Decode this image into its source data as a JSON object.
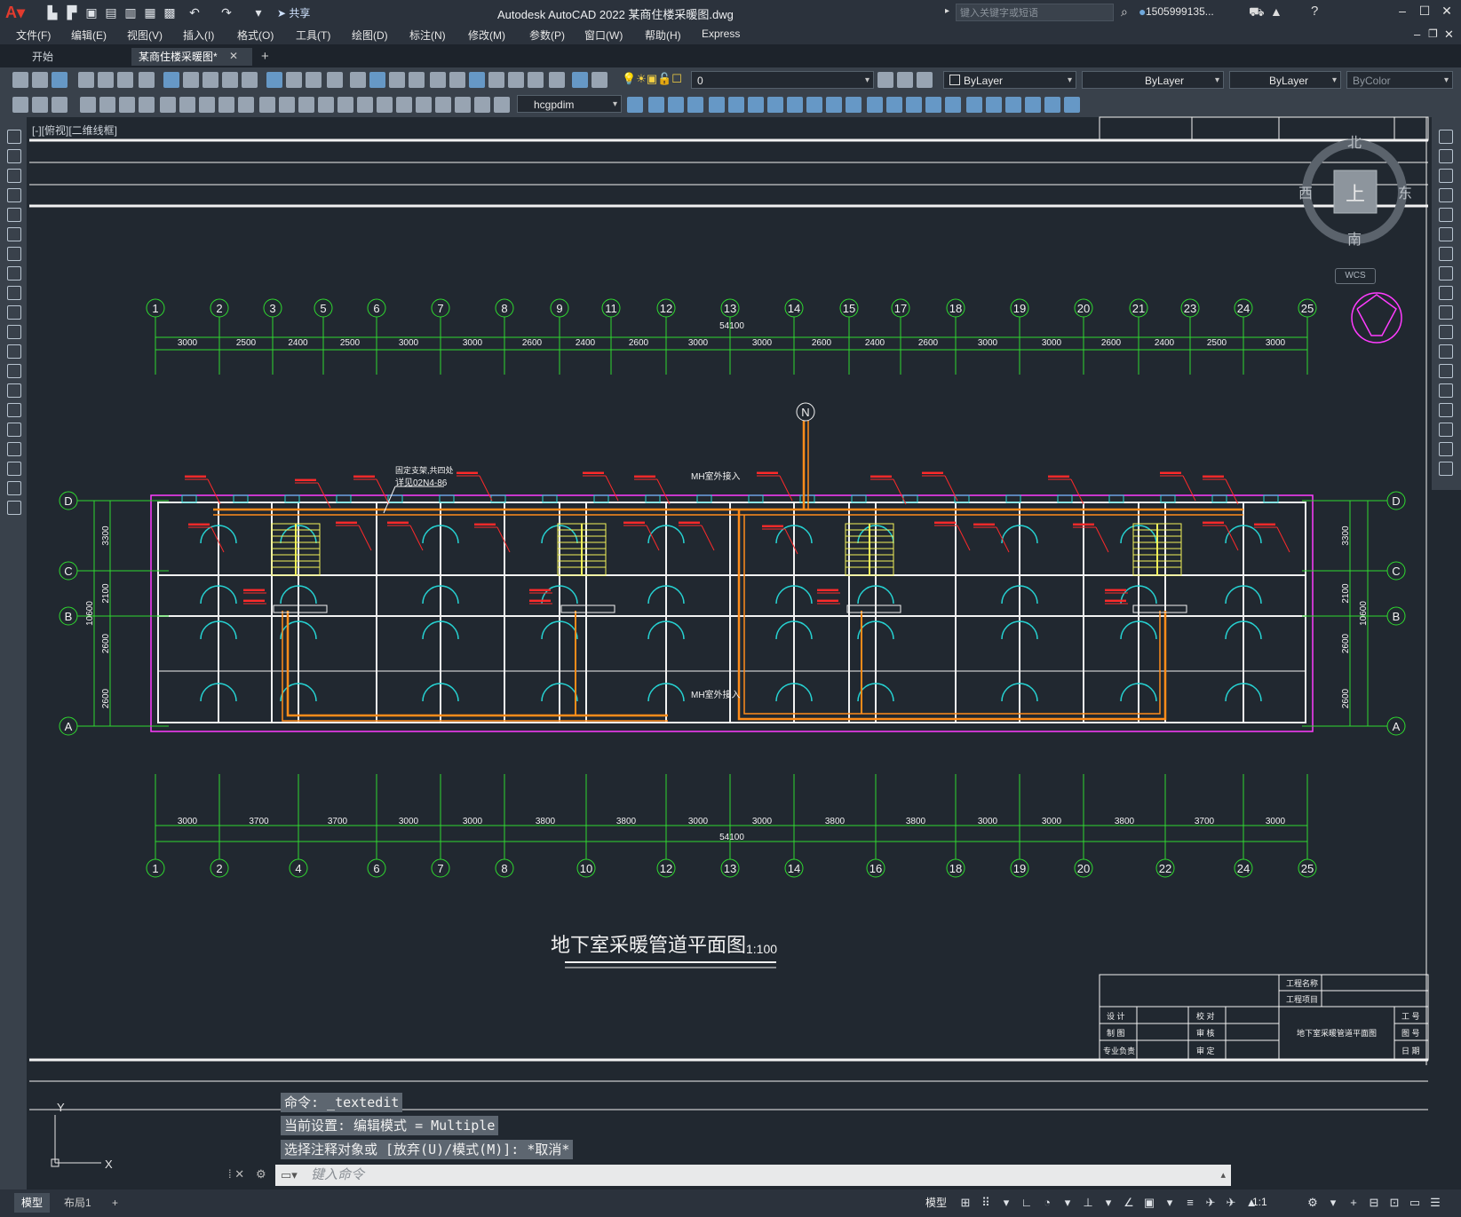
{
  "app": {
    "title": "Autodesk AutoCAD 2022    某商住楼采暖图.dwg",
    "share_label": "共享",
    "search_placeholder": "键入关键字或短语",
    "user": "1505999135...",
    "menus": [
      "文件(F)",
      "编辑(E)",
      "视图(V)",
      "插入(I)",
      "格式(O)",
      "工具(T)",
      "绘图(D)",
      "标注(N)",
      "修改(M)",
      "参数(P)",
      "窗口(W)",
      "帮助(H)",
      "Express"
    ]
  },
  "tabs": {
    "start": "开始",
    "active": "某商住楼采暖图*",
    "add": "+"
  },
  "toolbar": {
    "layer_value": "0",
    "color_value": "ByLayer",
    "linetype_value": "ByLayer",
    "lineweight_value": "ByLayer",
    "plotstyle_value": "ByColor",
    "dimstyle_value": "hcgpdim"
  },
  "view": {
    "label": "[-][俯视][二维线框]",
    "cube": {
      "north": "北",
      "south": "南",
      "east": "东",
      "west": "西",
      "top": "上"
    },
    "wcs": "WCS"
  },
  "drawing": {
    "top_axes": [
      "1",
      "2",
      "3",
      "5",
      "6",
      "7",
      "8",
      "9",
      "11",
      "12",
      "13",
      "14",
      "15",
      "17",
      "18",
      "19",
      "20",
      "21",
      "23",
      "24",
      "25"
    ],
    "top_dims": [
      "3000",
      "2500",
      "2400",
      "2500",
      "3000",
      "3000",
      "2600",
      "2400",
      "2600",
      "3000",
      "3000",
      "2600",
      "2400",
      "2600",
      "3000",
      "3000",
      "2600",
      "2400",
      "2500",
      "3000"
    ],
    "top_total": "54100",
    "bottom_axes": [
      "1",
      "2",
      "4",
      "6",
      "7",
      "8",
      "10",
      "12",
      "13",
      "14",
      "16",
      "18",
      "19",
      "20",
      "22",
      "24",
      "25"
    ],
    "bottom_dims": [
      "3000",
      "3700",
      "3700",
      "3000",
      "3000",
      "3800",
      "3800",
      "3000",
      "3000",
      "3800",
      "3800",
      "3000",
      "3000",
      "3800",
      "3700",
      "3000"
    ],
    "bottom_total": "54100",
    "row_axes": [
      "D",
      "C",
      "B",
      "A"
    ],
    "left_dims": [
      "3300",
      "2100",
      "2600",
      "2600"
    ],
    "left_total": "10600",
    "right_dims": [
      "3300",
      "2100",
      "2600",
      "2600"
    ],
    "right_total": "10600",
    "north_label": "N",
    "mh_label_top": "MH室外接入",
    "mh_label_bottom": "MH室外接入",
    "note_line1": "固定支架,共四处",
    "note_line2": "详见02N4-86",
    "title": "地下室采暖管道平面图",
    "scale": "1:100",
    "titleblock": {
      "project_name": "工程名称",
      "project_item": "工程项目",
      "design": "设 计",
      "check": "校 对",
      "draw": "制 图",
      "review": "审 核",
      "specialty": "专业负责",
      "approve": "审 定",
      "drawing_name": "地下室采暖管道平面图",
      "no": "工 号",
      "sheet": "图 号",
      "date": "日 期"
    }
  },
  "command": {
    "history": [
      "命令: _textedit",
      "当前设置: 编辑模式 = Multiple",
      "选择注释对象或 [放弃(U)/模式(M)]: *取消*"
    ],
    "input_placeholder": "键入命令"
  },
  "status": {
    "model_tab": "模型",
    "layout_tab": "布局1",
    "add_tab": "+",
    "model_button": "模型",
    "scale": "1:1"
  },
  "colors": {
    "green": "#2fd92f",
    "red": "#ff2a2a",
    "orange": "#ff8c1a",
    "cyan": "#26d3d3",
    "magenta": "#ff3cff",
    "yellow": "#f2f25a",
    "white": "#f2f2f2"
  }
}
